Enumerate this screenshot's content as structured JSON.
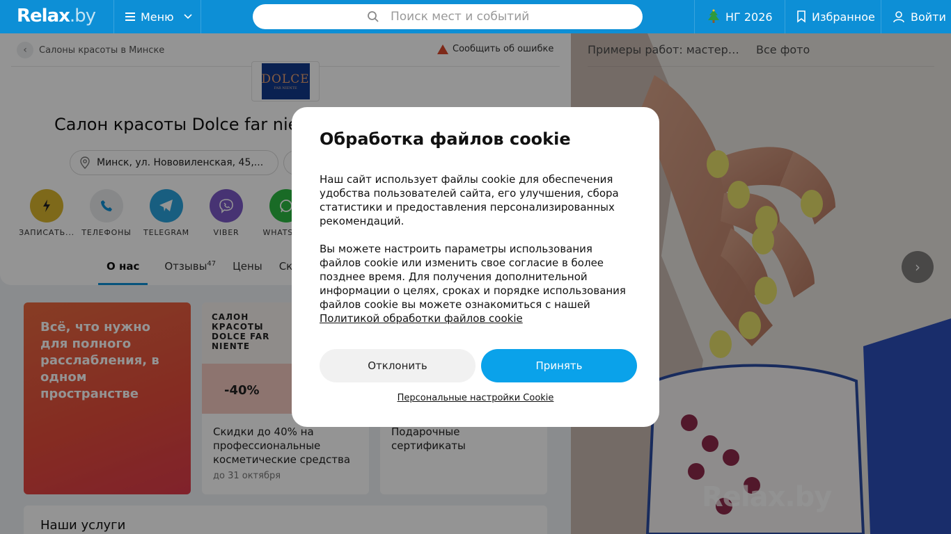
{
  "header": {
    "logo": "Relax",
    "logo_suffix": ".by",
    "menu_label": "Меню",
    "search_placeholder": "Поиск мест и событий",
    "ng_label": "НГ 2026",
    "favorites_label": "Избранное",
    "login_label": "Войти"
  },
  "breadcrumb": {
    "label": "Салоны красоты в Минске"
  },
  "report_error": "Сообщить об ошибке",
  "brand_logo": {
    "title": "DOLCE",
    "subtitle": "FAR NIENTE"
  },
  "place": {
    "title": "Салон красоты Dolce far niente",
    "address": "Минск, ул. Нововиленская, 45,..."
  },
  "actions": [
    {
      "label": "ЗАПИСАТЬ...",
      "icon": "lightning-icon",
      "color": "#d9b52e"
    },
    {
      "label": "ТЕЛЕФОНЫ",
      "icon": "phone-icon",
      "color": "#e8eaec"
    },
    {
      "label": "TELEGRAM",
      "icon": "telegram-icon",
      "color": "#2aa3dd"
    },
    {
      "label": "VIBER",
      "icon": "viber-icon",
      "color": "#7b58c6"
    },
    {
      "label": "WHATSAPP",
      "icon": "whatsapp-icon",
      "color": "#2cb843"
    }
  ],
  "tabs": [
    {
      "label": "О нас",
      "active": true
    },
    {
      "label": "Отзывы",
      "badge": "47"
    },
    {
      "label": "Цены"
    },
    {
      "label": "Скидки"
    }
  ],
  "promo_red": {
    "text": "Всё, что нужно для полного расслабления, в одном пространстве"
  },
  "promo_cards": [
    {
      "caption": "САЛОН КРАСОТЫ DOLCE FAR NIENTE",
      "badge": "-40%",
      "desc": "Скидки до 40% на профессиональные косметические средства",
      "until": "до 31 октября"
    },
    {
      "caption": "",
      "badge": "",
      "desc": "Подарочные сертификаты",
      "until": ""
    }
  ],
  "services_heading": "Наши услуги",
  "photo_panel": {
    "title": "Примеры работ: мастер маникюра",
    "all_photos": "Все фото",
    "watermark": "Relax.by"
  },
  "cookie_modal": {
    "title": "Обработка файлов cookie",
    "paragraph1": "Наш сайт использует файлы cookie для обеспечения удобства пользователей сайта, его улучшения, сбора статистики и предоставления персонализированных рекомендаций.",
    "paragraph2": "Вы можете настроить параметры использования файлов cookie или изменить свое согласие в более позднее время. Для получения дополнительной информации о целях, сроках и порядке использования файлов cookie вы можете ознакомиться с нашей",
    "policy_link": "Политикой обработки файлов cookie",
    "decline_label": "Отклонить",
    "accept_label": "Принять",
    "personal_settings": "Персональные настройки Cookie"
  }
}
